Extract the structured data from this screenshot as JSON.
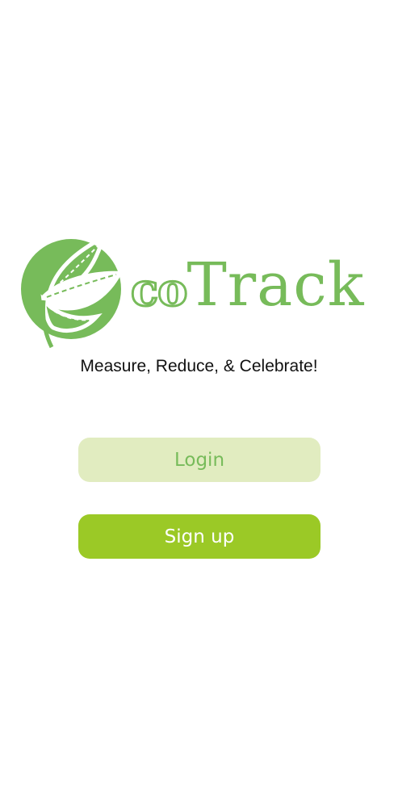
{
  "logo": {
    "part1": "co",
    "part2": "Track"
  },
  "tagline": "Measure, Reduce, & Celebrate!",
  "buttons": {
    "login_label": "Login",
    "signup_label": "Sign up"
  },
  "colors": {
    "brand_green": "#77bb5a",
    "login_bg": "#e1ecc0",
    "signup_bg": "#9bc926"
  }
}
